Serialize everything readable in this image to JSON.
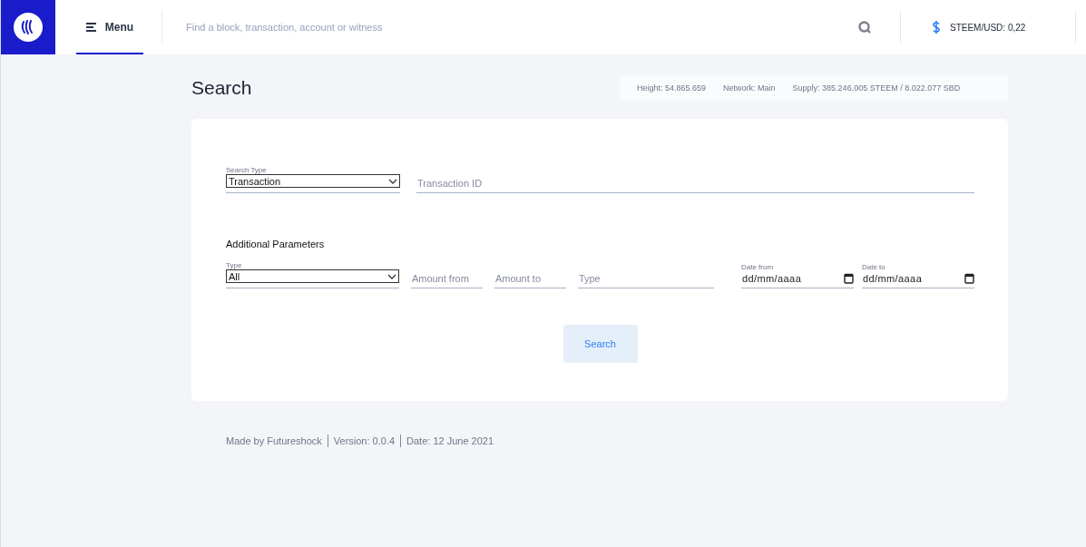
{
  "header": {
    "menu": {
      "label": "Menu",
      "selected": true
    },
    "search": {
      "placeholder": "Find a block, transaction, account or witness"
    },
    "price": "STEEM/USD: 0,22"
  },
  "page": {
    "title": "Search",
    "stats": [
      "Height: 54.865.659",
      "Network: Main",
      "Supply: 385.246.005 STEEM / 8.022.077 SBD"
    ]
  },
  "form": {
    "search_type": {
      "label": "Search Type",
      "value": "Transaction"
    },
    "transaction_id": {
      "placeholder": "Transaction ID"
    },
    "section_title": "Additional Parameters",
    "type_select": {
      "label": "Type",
      "value": "All"
    },
    "amount_from": {
      "placeholder": "Amount from"
    },
    "amount_to": {
      "placeholder": "Amount to"
    },
    "type_field": {
      "placeholder": "Type"
    },
    "dates": [
      {
        "label": "Date from",
        "value": "dd/mm/aaaa"
      },
      {
        "label": "Date to",
        "value": "dd/mm/aaaa"
      }
    ],
    "button": "Search"
  },
  "footer": [
    "Made by Futureshock",
    "Version: 0.0.4",
    "Date: 12 June 2021"
  ]
}
